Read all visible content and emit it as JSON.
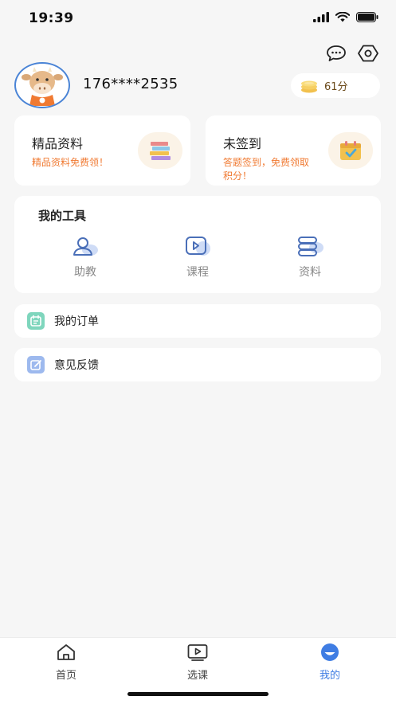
{
  "status_bar": {
    "time": "19:39"
  },
  "header": {
    "phone": "176****2535",
    "points": "61分"
  },
  "promo_cards": [
    {
      "title": "精品资料",
      "desc": "精品资料免费领！"
    },
    {
      "title": "未签到",
      "desc": "答题签到，免费领取积分！"
    }
  ],
  "tools": {
    "heading": "我的工具",
    "items": [
      {
        "label": "助教",
        "icon": "assistant-icon"
      },
      {
        "label": "课程",
        "icon": "course-icon"
      },
      {
        "label": "资料",
        "icon": "materials-icon"
      }
    ]
  },
  "rows": [
    {
      "label": "我的订单",
      "icon": "order-icon"
    },
    {
      "label": "意见反馈",
      "icon": "feedback-icon"
    }
  ],
  "tabbar": {
    "items": [
      {
        "label": "首页",
        "icon": "home-icon"
      },
      {
        "label": "选课",
        "icon": "video-icon"
      },
      {
        "label": "我的",
        "icon": "profile-icon",
        "active": true
      }
    ]
  },
  "colors": {
    "accent": "#3f7de3",
    "promo_text": "#f07a32",
    "background": "#f6f6f6"
  }
}
